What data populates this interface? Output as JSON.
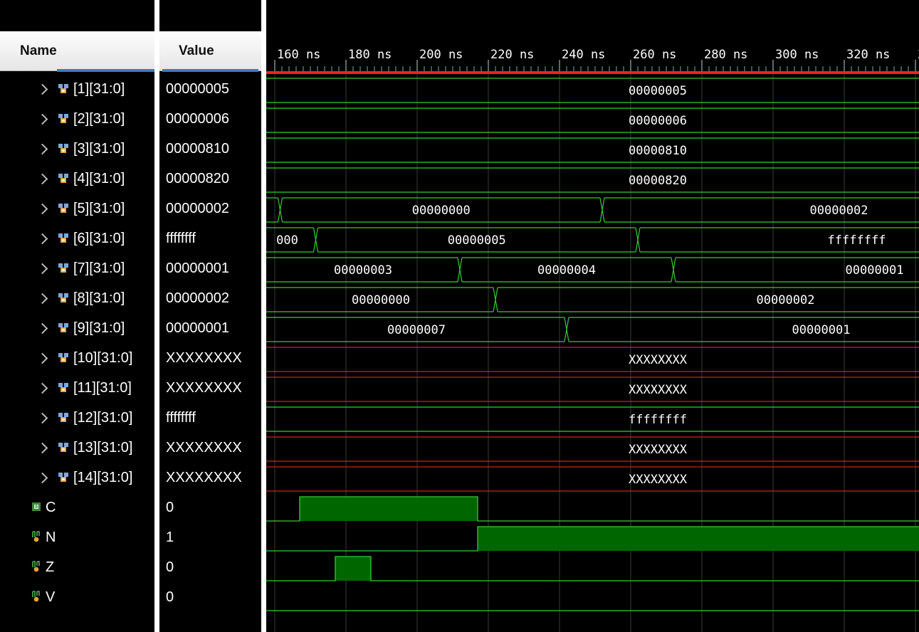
{
  "header": {
    "name_label": "Name",
    "value_label": "Value"
  },
  "timeline": {
    "ticks": [
      "160 ns",
      "180 ns",
      "200 ns",
      "220 ns",
      "240 ns",
      "260 ns",
      "280 ns",
      "300 ns",
      "320 ns",
      "3"
    ]
  },
  "colors": {
    "valid": "#33cc33",
    "unknown": "#cc2222",
    "cursor": "#ee2222",
    "fill": "#006600"
  },
  "signals": [
    {
      "name": "[1][31:0]",
      "value": "00000005",
      "kind": "bus",
      "segs": [
        {
          "label": "00000005"
        }
      ]
    },
    {
      "name": "[2][31:0]",
      "value": "00000006",
      "kind": "bus",
      "segs": [
        {
          "label": "00000006"
        }
      ]
    },
    {
      "name": "[3][31:0]",
      "value": "00000810",
      "kind": "bus",
      "segs": [
        {
          "label": "00000810"
        }
      ]
    },
    {
      "name": "[4][31:0]",
      "value": "00000820",
      "kind": "bus",
      "segs": [
        {
          "label": "00000820"
        }
      ]
    },
    {
      "name": "[5][31:0]",
      "value": "00000002",
      "kind": "bus",
      "segs": [
        {
          "label": ""
        },
        {
          "label": "00000000"
        },
        {
          "label": "00000002"
        }
      ]
    },
    {
      "name": "[6][31:0]",
      "value": "ffffffff",
      "kind": "bus",
      "segs": [
        {
          "label": "000"
        },
        {
          "label": "00000005"
        },
        {
          "label": "ffffffff"
        }
      ]
    },
    {
      "name": "[7][31:0]",
      "value": "00000001",
      "kind": "bus",
      "segs": [
        {
          "label": "00000003"
        },
        {
          "label": "00000004"
        },
        {
          "label": "00000001"
        }
      ]
    },
    {
      "name": "[8][31:0]",
      "value": "00000002",
      "kind": "bus",
      "segs": [
        {
          "label": "00000000"
        },
        {
          "label": "00000002"
        }
      ]
    },
    {
      "name": "[9][31:0]",
      "value": "00000001",
      "kind": "bus",
      "segs": [
        {
          "label": "00000007"
        },
        {
          "label": "00000001"
        }
      ]
    },
    {
      "name": "[10][31:0]",
      "value": "XXXXXXXX",
      "kind": "busx",
      "segs": [
        {
          "label": "XXXXXXXX"
        }
      ]
    },
    {
      "name": "[11][31:0]",
      "value": "XXXXXXXX",
      "kind": "busx",
      "segs": [
        {
          "label": "XXXXXXXX"
        }
      ]
    },
    {
      "name": "[12][31:0]",
      "value": "ffffffff",
      "kind": "bus",
      "segs": [
        {
          "label": "ffffffff"
        }
      ]
    },
    {
      "name": "[13][31:0]",
      "value": "XXXXXXXX",
      "kind": "busx",
      "segs": [
        {
          "label": "XXXXXXXX"
        }
      ]
    },
    {
      "name": "[14][31:0]",
      "value": "XXXXXXXX",
      "kind": "busx",
      "segs": [
        {
          "label": "XXXXXXXX"
        }
      ]
    },
    {
      "name": "C",
      "value": "0",
      "kind": "bit",
      "icon": "bit-output-icon"
    },
    {
      "name": "N",
      "value": "1",
      "kind": "bit",
      "icon": "bit-signal-icon"
    },
    {
      "name": "Z",
      "value": "0",
      "kind": "bit",
      "icon": "bit-signal-icon"
    },
    {
      "name": "V",
      "value": "0",
      "kind": "bit",
      "icon": "bit-signal-icon"
    }
  ]
}
